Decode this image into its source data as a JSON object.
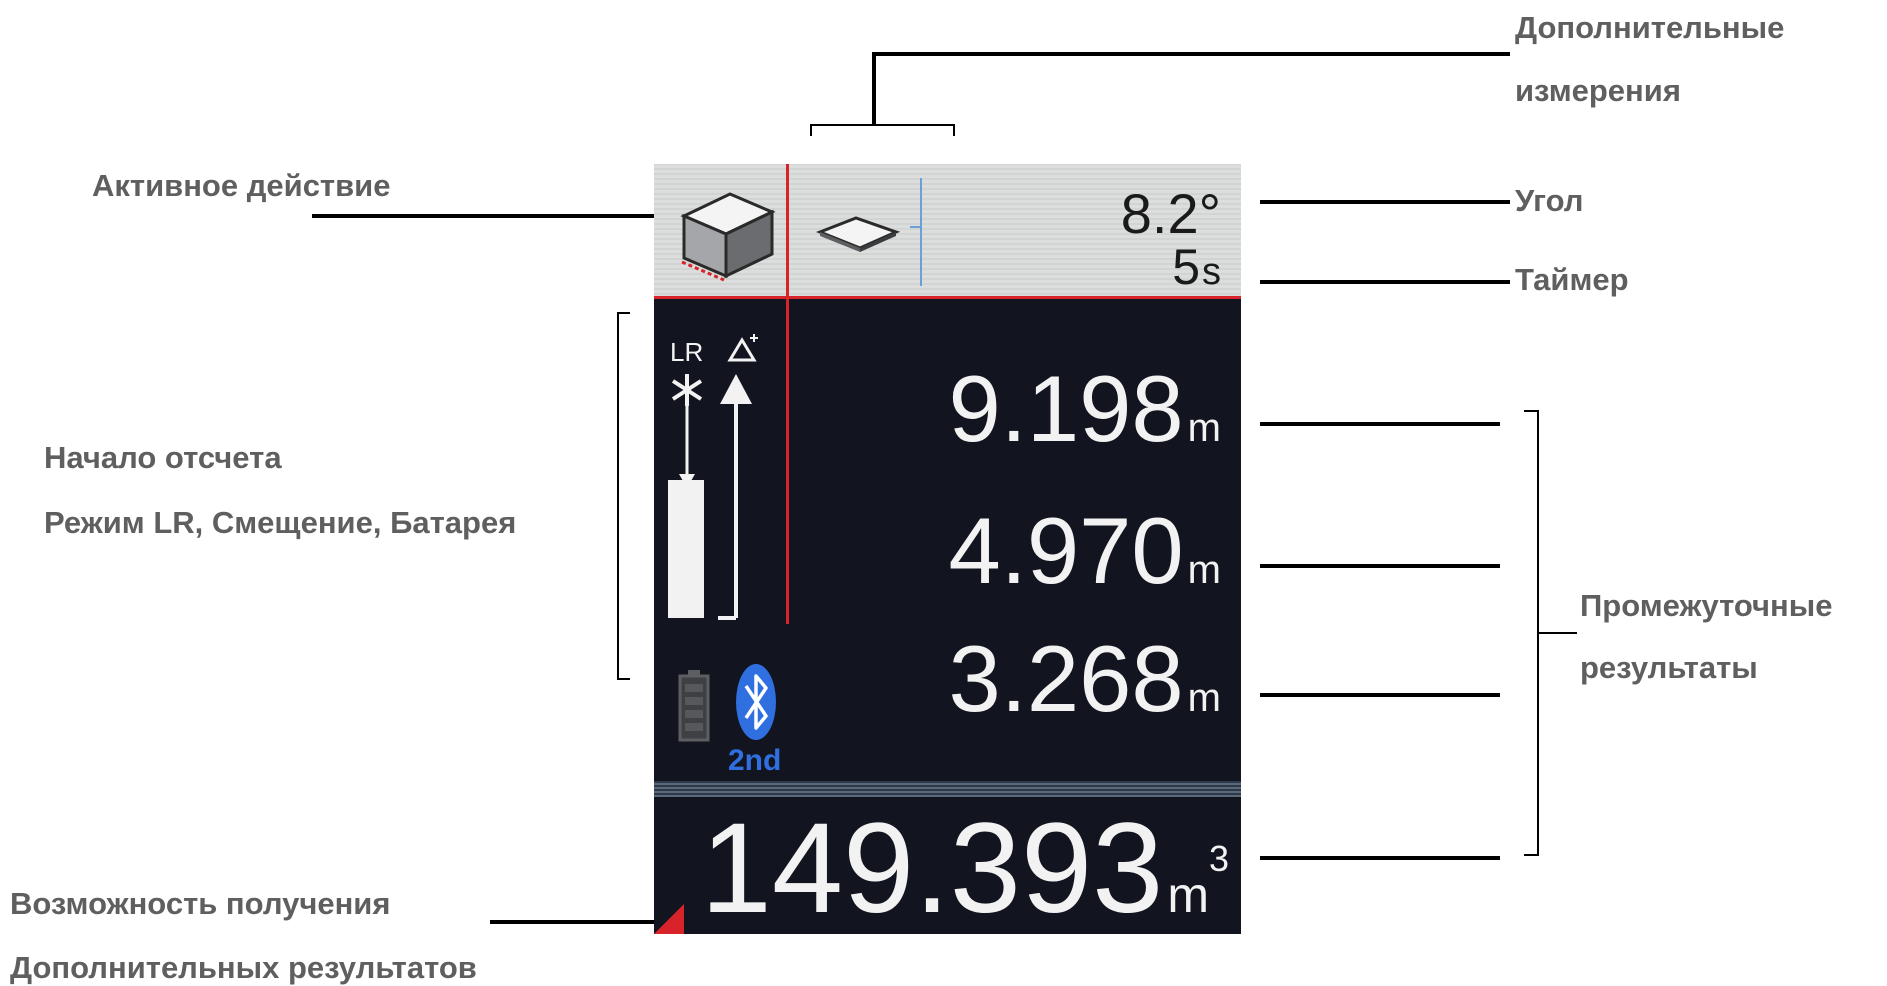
{
  "labels": {
    "extra_measurements": [
      "Дополнительные",
      "измерения"
    ],
    "active_action": "Активное действие",
    "angle": "Угол",
    "timer": "Таймер",
    "reference": [
      "Начало отсчета",
      "Режим LR, Смещение, Батарея"
    ],
    "intermediate": [
      "Промежуточные",
      "результаты"
    ],
    "more_results": [
      "Возможность получения",
      "Дополнительных результатов"
    ]
  },
  "screen": {
    "angle_value": "8.2°",
    "timer_value": "5",
    "timer_unit": "s",
    "lr_label": "LR",
    "bluetooth_label": "2nd",
    "results": [
      {
        "value": "9.198",
        "unit": "m"
      },
      {
        "value": "4.970",
        "unit": "m"
      },
      {
        "value": "3.268",
        "unit": "m"
      }
    ],
    "main_result": {
      "value": "149.393",
      "unit": "m",
      "exponent": "3"
    }
  },
  "colors": {
    "accent_red": "#d8232a",
    "bluetooth_blue": "#2f6fe0",
    "screen_bg": "#12151f",
    "label_gray": "#5f5f5f"
  }
}
